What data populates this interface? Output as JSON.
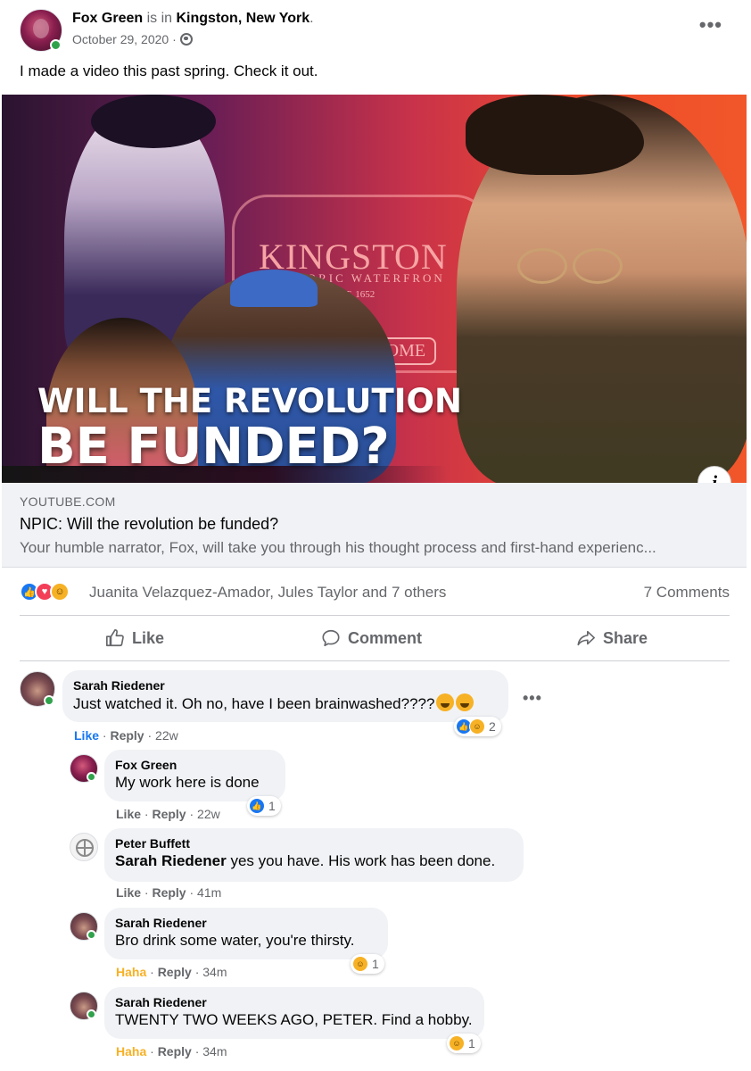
{
  "post": {
    "author": "Fox Green",
    "is_in": "is in",
    "location": "Kingston, New York",
    "location_suffix": ".",
    "date": "October 29, 2020 ·",
    "text": "I made a video this past spring. Check it out.",
    "more_icon": "more-dots-icon",
    "privacy_icon": "globe-icon"
  },
  "thumbnail": {
    "sign_title": "KINGSTON",
    "sign_sub": "TORIC WATERFRON",
    "sign_est": "EST. 1652",
    "sign_welcome": "WELCOME",
    "line1": "WILL THE REVOLUTION",
    "line2": "BE FUNDED?",
    "info": "i"
  },
  "link": {
    "domain": "YOUTUBE.COM",
    "title": "NPIC: Will the revolution be funded?",
    "description": "Your humble narrator, Fox, will take you through his thought process and first-hand experienc..."
  },
  "reactions": {
    "names": "Juanita Velazquez-Amador, Jules Taylor and 7 others",
    "comments_count": "7 Comments",
    "types": [
      "like",
      "love",
      "haha"
    ]
  },
  "actions": {
    "like": "Like",
    "comment": "Comment",
    "share": "Share"
  },
  "comments": [
    {
      "name": "Sarah Riedener",
      "text": "Just watched it. Oh no, have I been brainwashed????",
      "like": "Like",
      "reply": "Reply",
      "time": "22w",
      "reaction_count": "2"
    },
    {
      "name": "Fox Green",
      "text": "My work here is done",
      "like": "Like",
      "reply": "Reply",
      "time": "22w",
      "reaction_count": "1"
    },
    {
      "name": "Peter Buffett",
      "mention": "Sarah Riedener",
      "text": " yes you have. His work has been done.",
      "like": "Like",
      "reply": "Reply",
      "time": "41m"
    },
    {
      "name": "Sarah Riedener",
      "text": "Bro drink some water, you're thirsty.",
      "like": "Haha",
      "reply": "Reply",
      "time": "34m",
      "reaction_count": "1"
    },
    {
      "name": "Sarah Riedener",
      "text": "TWENTY TWO WEEKS AGO, PETER. Find a hobby.",
      "like": "Haha",
      "reply": "Reply",
      "time": "34m",
      "reaction_count": "1"
    }
  ],
  "colors": {
    "facebook_blue": "#1877f2",
    "haha_yellow": "#f7b125",
    "online_green": "#31a24c"
  }
}
